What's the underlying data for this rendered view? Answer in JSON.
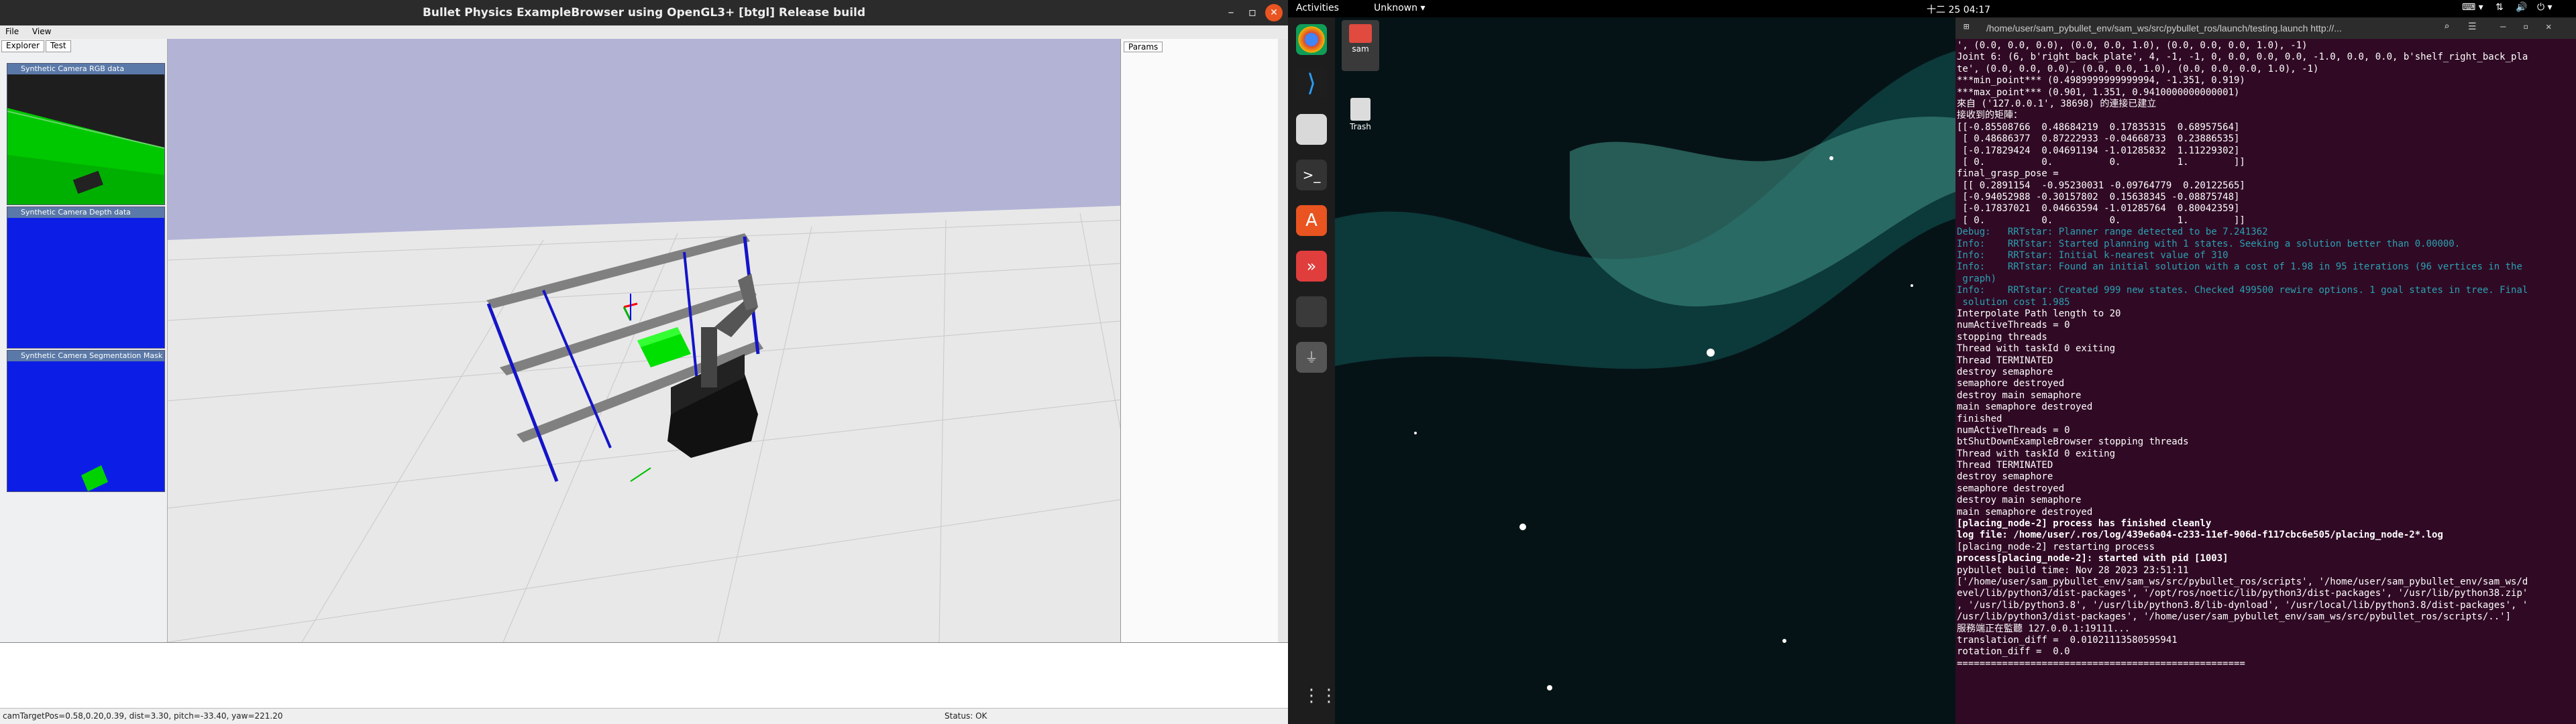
{
  "bullet": {
    "title": "Bullet Physics ExampleBrowser using OpenGL3+ [btgl] Release build",
    "menu": [
      "File",
      "View"
    ],
    "tabs": [
      "Explorer",
      "Test"
    ],
    "cams": [
      "Synthetic Camera RGB data",
      "Synthetic Camera Depth data",
      "Synthetic Camera Segmentation Mask"
    ],
    "params_tab": "Params",
    "status_left": "camTargetPos=0.58,0.20,0.39, dist=3.30, pitch=-33.40, yaw=221.20",
    "status_right": "Status: OK"
  },
  "topbar": {
    "activities": "Activities",
    "app": "Unknown",
    "clock": "十二 25 04:17"
  },
  "desktop": {
    "home_label": "sam",
    "trash_label": "Trash"
  },
  "terminal": {
    "title": "/home/user/sam_pybullet_env/sam_ws/src/pybullet_ros/launch/testing.launch http://...",
    "lines": [
      "', (0.0, 0.0, 0.0), (0.0, 0.0, 1.0), (0.0, 0.0, 0.0, 1.0), -1)",
      "Joint 6: (6, b'right_back_plate', 4, -1, -1, 0, 0.0, 0.0, 0.0, -1.0, 0.0, 0.0, b'shelf_right_back_pla",
      "te', (0.0, 0.0, 0.0), (0.0, 0.0, 1.0), (0.0, 0.0, 0.0, 1.0), -1)",
      "***min_point*** (0.4989999999999994, -1.351, 0.919)",
      "***max_point*** (0.901, 1.351, 0.9410000000000001)",
      "來自 ('127.0.0.1', 38698) 的連接已建立",
      "接收到的矩陣：",
      "[[-0.85508766  0.48684219  0.17835315  0.68957564]",
      " [ 0.48686377  0.87222933 -0.04668733  0.23886535]",
      " [-0.17829424  0.04691194 -1.01285832  1.11229302]",
      " [ 0.          0.          0.          1.        ]]",
      "final_grasp_pose =",
      " [[ 0.2891154  -0.95230031 -0.09764779  0.20122565]",
      " [-0.94052988 -0.30157802  0.15638345 -0.08875748]",
      " [-0.17837021  0.04663594 -1.01285764  0.80042359]",
      " [ 0.          0.          0.          1.        ]]",
      "Debug:   RRTstar: Planner range detected to be 7.241362",
      "Info:    RRTstar: Started planning with 1 states. Seeking a solution better than 0.00000.",
      "Info:    RRTstar: Initial k-nearest value of 310",
      "Info:    RRTstar: Found an initial solution with a cost of 1.98 in 95 iterations (96 vertices in the",
      " graph)",
      "Info:    RRTstar: Created 999 new states. Checked 499500 rewire options. 1 goal states in tree. Final",
      " solution cost 1.985",
      "Interpolate Path length to 20",
      "numActiveThreads = 0",
      "stopping threads",
      "Thread with taskId 0 exiting",
      "Thread TERMINATED",
      "destroy semaphore",
      "semaphore destroyed",
      "destroy main semaphore",
      "main semaphore destroyed",
      "finished",
      "numActiveThreads = 0",
      "btShutDownExampleBrowser stopping threads",
      "Thread with taskId 0 exiting",
      "Thread TERMINATED",
      "destroy semaphore",
      "semaphore destroyed",
      "destroy main semaphore",
      "main semaphore destroyed",
      "[placing_node-2] process has finished cleanly",
      "log file: /home/user/.ros/log/439e6a04-c233-11ef-906d-f117cbc6e505/placing_node-2*.log",
      "[placing_node-2] restarting process",
      "process[placing_node-2]: started with pid [1003]",
      "pybullet build time: Nov 28 2023 23:51:11",
      "['/home/user/sam_pybullet_env/sam_ws/src/pybullet_ros/scripts', '/home/user/sam_pybullet_env/sam_ws/d",
      "evel/lib/python3/dist-packages', '/opt/ros/noetic/lib/python3/dist-packages', '/usr/lib/python38.zip'",
      ", '/usr/lib/python3.8', '/usr/lib/python3.8/lib-dynload', '/usr/local/lib/python3.8/dist-packages', '",
      "/usr/lib/python3/dist-packages', '/home/user/sam_pybullet_env/sam_ws/src/pybullet_ros/scripts/..']",
      "服務端正在監聽 127.0.0.1:19111...",
      "translation_diff =  0.01021113580595941",
      "rotation_diff =  0.0",
      "==================================================="
    ]
  },
  "colors": {
    "terminal_bg": "#300a24",
    "info_text": "#2aa1b3",
    "ubuntu_orange": "#e95420",
    "sky": "#b4b4d7"
  }
}
